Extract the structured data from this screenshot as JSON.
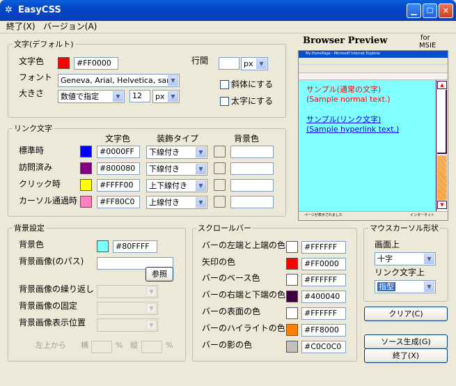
{
  "window": {
    "title": "EasyCSS"
  },
  "menu": [
    "終了(X)",
    "バージョン(A)"
  ],
  "text_group": {
    "title": "文字(デフォルト)",
    "color_label": "文字色",
    "color_value": "#FF0000",
    "color": "#ff0000",
    "font_label": "フォント",
    "font_value": "Geneva, Arial, Helvetica, san-s",
    "size_label": "大きさ",
    "size_mode": "数値で指定",
    "size_value": "12",
    "size_unit": "px",
    "line_label": "行間",
    "line_value": "",
    "line_unit": "px",
    "italic_label": "斜体にする",
    "bold_label": "太字にする"
  },
  "link_group": {
    "title": "リンク文字",
    "col_color": "文字色",
    "col_decoration": "装飾タイプ",
    "col_bg": "背景色",
    "rows": [
      {
        "label": "標準時",
        "color_value": "#0000FF",
        "color": "#0000ff",
        "decoration": "下線付き",
        "bg": ""
      },
      {
        "label": "訪問済み",
        "color_value": "#800080",
        "color": "#800080",
        "decoration": "下線付き",
        "bg": ""
      },
      {
        "label": "クリック時",
        "color_value": "#FFFF00",
        "color": "#ffff00",
        "decoration": "上下線付き",
        "bg": ""
      },
      {
        "label": "カーソル通過時",
        "color_value": "#FF80C0",
        "color": "#ff80c0",
        "decoration": "上線付き",
        "bg": ""
      }
    ]
  },
  "bg_group": {
    "title": "背景設定",
    "color_label": "背景色",
    "color_value": "#80FFFF",
    "color": "#80ffff",
    "image_label": "背景画像(のパス)",
    "image_value": "",
    "browse_label": "参照",
    "repeat_label": "背景画像の繰り返し",
    "fixed_label": "背景画像の固定",
    "position_label": "背景画像表示位置",
    "offset_label": "左上から",
    "h_label": "横",
    "v_label": "縦",
    "pct1": "%",
    "pct2": "%"
  },
  "scroll_group": {
    "title": "スクロールバー",
    "rows": [
      {
        "label": "バーの左端と上端の色",
        "value": "#FFFFFF",
        "color": "#ffffff"
      },
      {
        "label": "矢印の色",
        "value": "#FF0000",
        "color": "#ff0000"
      },
      {
        "label": "バーのベース色",
        "value": "#FFFFFF",
        "color": "#ffffff"
      },
      {
        "label": "バーの右端と下端の色",
        "value": "#400040",
        "color": "#400040"
      },
      {
        "label": "バーの表面の色",
        "value": "#FFFFFF",
        "color": "#ffffff"
      },
      {
        "label": "バーのハイライトの色",
        "value": "#FF8000",
        "color": "#ff8000"
      },
      {
        "label": "バーの影の色",
        "value": "#C0C0C0",
        "color": "#c0c0c0"
      }
    ]
  },
  "cursor_group": {
    "title": "マウスカーソル形状",
    "screen_label": "画面上",
    "screen_value": "十字",
    "link_label": "リンク文字上",
    "link_value": "指型"
  },
  "preview": {
    "title": "Browser Preview",
    "for_label": "for",
    "browser": "MSIE",
    "ie_title": "My HomePage - Microsoft Internet Explorer",
    "normal_jp": "サンプル(通常の文字)",
    "normal_en": "(Sample normal text.)",
    "link_jp": "サンプル(リンク文字)",
    "link_en": "(Sample hyperlink text.)",
    "status_left": "ページが表示されました",
    "status_right": "インターネット"
  },
  "buttons": {
    "clear": "クリア(C)",
    "source": "ソース生成(G)",
    "exit": "終了(X)"
  }
}
